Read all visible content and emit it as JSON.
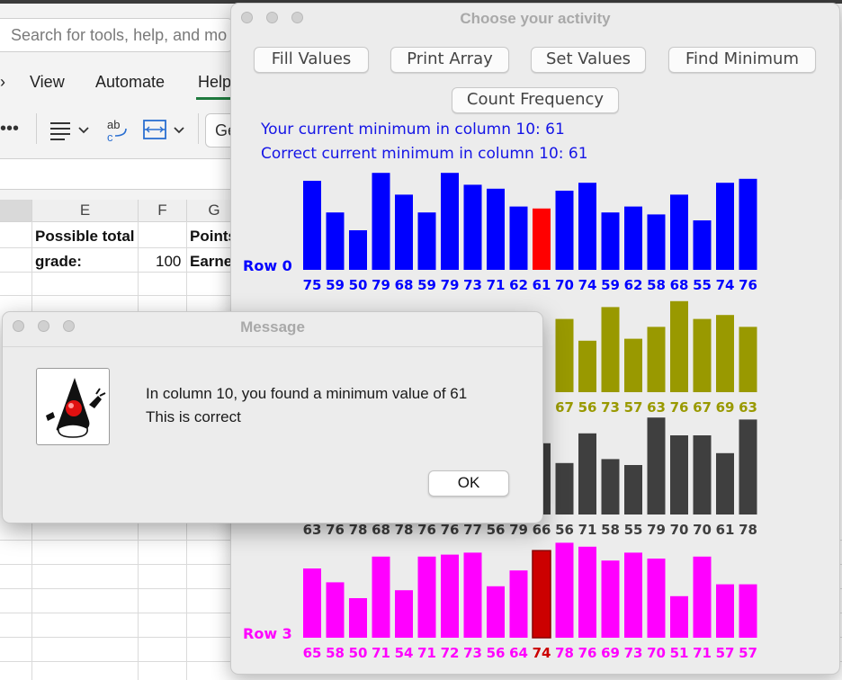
{
  "excel": {
    "search_placeholder": "Search for tools, help, and mo",
    "menu": [
      "View",
      "Automate",
      "Help"
    ],
    "font_box_text": "Ge",
    "columns": [
      "E",
      "F",
      "G"
    ],
    "cells": {
      "e1": "Possible total",
      "e2": "grade:",
      "f2": "100",
      "g1": "Points",
      "g2": "Earne"
    }
  },
  "activity": {
    "title": "Choose your activity",
    "buttons": [
      "Fill Values",
      "Print Array",
      "Set Values",
      "Find Minimum",
      "Count Frequency"
    ],
    "message_line1": "Your current minimum in column 10: 61",
    "message_line2": "Correct current minimum in column 10: 61",
    "rows": [
      {
        "label": "Row 0",
        "color": "#0000ff",
        "highlight_index": 10,
        "highlight_color": "#ff0000",
        "values": [
          75,
          59,
          50,
          79,
          68,
          59,
          79,
          73,
          71,
          62,
          61,
          70,
          74,
          59,
          62,
          58,
          68,
          55,
          74,
          76
        ]
      },
      {
        "label": "",
        "color": "#999900",
        "highlight_index": null,
        "highlight_color": "",
        "values": [
          null,
          null,
          null,
          null,
          null,
          null,
          null,
          null,
          null,
          null,
          null,
          67,
          56,
          73,
          57,
          63,
          76,
          67,
          69,
          63
        ]
      },
      {
        "label": "",
        "color": "#3f3f3f",
        "highlight_index": null,
        "highlight_color": "",
        "values": [
          63,
          76,
          78,
          68,
          78,
          76,
          76,
          77,
          56,
          79,
          66,
          56,
          71,
          58,
          55,
          79,
          70,
          70,
          61,
          78
        ]
      },
      {
        "label": "Row 3",
        "color": "#ff00ff",
        "highlight_index": 10,
        "highlight_color": "#cc0000",
        "values": [
          65,
          58,
          50,
          71,
          54,
          71,
          72,
          73,
          56,
          64,
          74,
          78,
          76,
          69,
          73,
          70,
          51,
          71,
          57,
          57
        ]
      }
    ]
  },
  "message": {
    "title": "Message",
    "line1": "In column 10, you found a minimum value of 61",
    "line2": "This is correct",
    "ok_label": "OK"
  }
}
